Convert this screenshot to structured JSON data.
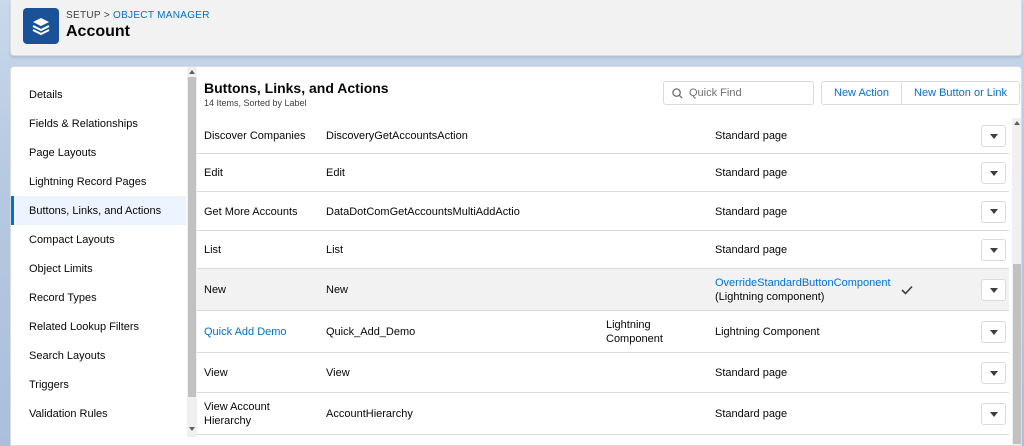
{
  "header": {
    "breadcrumb_root": "SETUP",
    "breadcrumb_sep": ">",
    "breadcrumb_link": "OBJECT MANAGER",
    "title": "Account",
    "icon": "layers-icon"
  },
  "sidebar": {
    "items": [
      {
        "label": "Details",
        "active": false
      },
      {
        "label": "Fields & Relationships",
        "active": false
      },
      {
        "label": "Page Layouts",
        "active": false
      },
      {
        "label": "Lightning Record Pages",
        "active": false
      },
      {
        "label": "Buttons, Links, and Actions",
        "active": true
      },
      {
        "label": "Compact Layouts",
        "active": false
      },
      {
        "label": "Object Limits",
        "active": false
      },
      {
        "label": "Record Types",
        "active": false
      },
      {
        "label": "Related Lookup Filters",
        "active": false
      },
      {
        "label": "Search Layouts",
        "active": false
      },
      {
        "label": "Triggers",
        "active": false
      },
      {
        "label": "Validation Rules",
        "active": false
      }
    ]
  },
  "main": {
    "title": "Buttons, Links, and Actions",
    "subtitle": "14 Items, Sorted by Label",
    "search": {
      "placeholder": "Quick Find",
      "value": ""
    },
    "buttons": {
      "new_action": "New Action",
      "new_button_link": "New Button or Link"
    },
    "rows": [
      {
        "label": "Discover Companies",
        "name": "DiscoveryGetAccountsAction",
        "type": "",
        "override": "Standard page",
        "override_sub": "",
        "label_link": false,
        "override_link": false,
        "checked": false
      },
      {
        "label": "Edit",
        "name": "Edit",
        "type": "",
        "override": "Standard page",
        "override_sub": "",
        "label_link": false,
        "override_link": false,
        "checked": false
      },
      {
        "label": "Get More Accounts",
        "name": "DataDotComGetAccountsMultiAddActio",
        "type": "",
        "override": "Standard page",
        "override_sub": "",
        "label_link": false,
        "override_link": false,
        "checked": false
      },
      {
        "label": "List",
        "name": "List",
        "type": "",
        "override": "Standard page",
        "override_sub": "",
        "label_link": false,
        "override_link": false,
        "checked": false
      },
      {
        "label": "New",
        "name": "New",
        "type": "",
        "override": "OverrideStandardButtonComponent",
        "override_sub": "(Lightning component)",
        "label_link": false,
        "override_link": true,
        "checked": true
      },
      {
        "label": "Quick Add Demo",
        "name": "Quick_Add_Demo",
        "type": "Lightning",
        "type2": "Component",
        "override": "Lightning Component",
        "override_sub": "",
        "label_link": true,
        "override_link": false,
        "checked": false
      },
      {
        "label": "View",
        "name": "View",
        "type": "",
        "override": "Standard page",
        "override_sub": "",
        "label_link": false,
        "override_link": false,
        "checked": false
      },
      {
        "label": "View Account",
        "label2": "Hierarchy",
        "name": "AccountHierarchy",
        "type": "",
        "override": "Standard page",
        "override_sub": "",
        "label_link": false,
        "override_link": false,
        "checked": false
      }
    ]
  },
  "colors": {
    "brand": "#1b5297",
    "link": "#0070d2",
    "active_bg": "#eef4ff",
    "border": "#dddbda"
  }
}
